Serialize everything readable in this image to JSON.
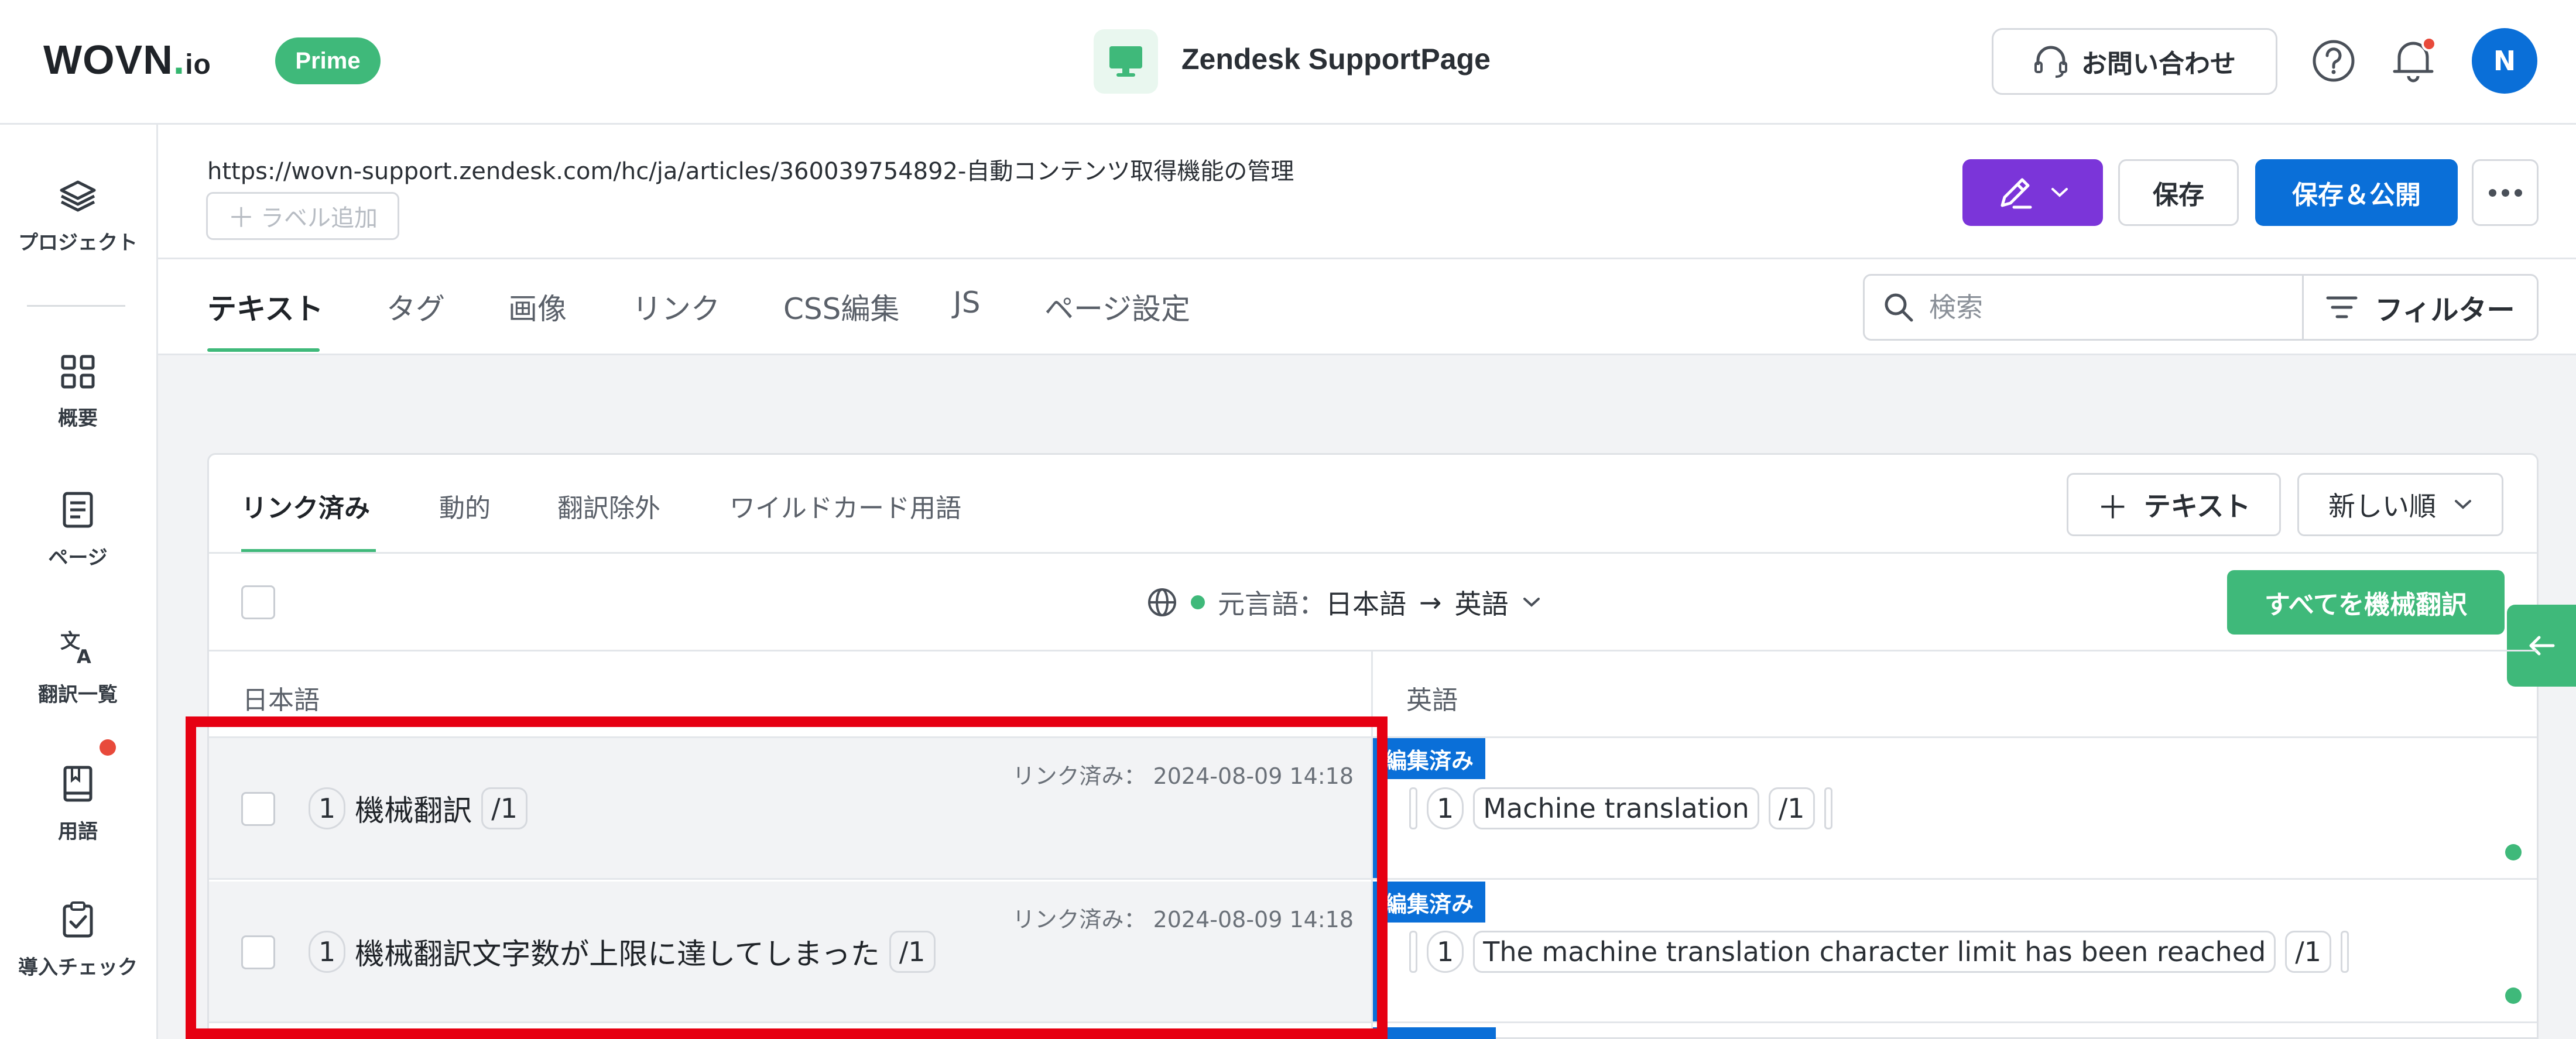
{
  "header": {
    "logo_main": "WOVN",
    "logo_dot": ".",
    "logo_suffix": "io",
    "plan_badge": "Prime",
    "site_name": "Zendesk SupportPage",
    "contact_label": "お問い合わせ",
    "avatar_initial": "N",
    "colors": {
      "brand_green": "#3fb97a",
      "primary_blue": "#0a6fd8",
      "edit_purple": "#7b35d9",
      "notification_red": "#e84a3b"
    }
  },
  "sidebar": {
    "items": [
      {
        "label": "プロジェクト",
        "icon": "layers-icon"
      },
      {
        "label": "概要",
        "icon": "grid-icon"
      },
      {
        "label": "ページ",
        "icon": "document-icon"
      },
      {
        "label": "翻訳一覧",
        "icon": "translate-icon"
      },
      {
        "label": "用語",
        "icon": "book-icon"
      },
      {
        "label": "導入チェック",
        "icon": "clipboard-check-icon"
      }
    ]
  },
  "page": {
    "url": "https://wovn-support.zendesk.com/hc/ja/articles/360039754892-自動コンテンツ取得機能の管理",
    "label_add": "ラベル追加",
    "save_label": "保存",
    "publish_label": "保存＆公開"
  },
  "main_tabs": [
    "テキスト",
    "タグ",
    "画像",
    "リンク",
    "CSS編集",
    "JS",
    "ページ設定"
  ],
  "search": {
    "placeholder": "検索",
    "value": ""
  },
  "filter_label": "フィルター",
  "sub_tabs": [
    "リンク済み",
    "動的",
    "翻訳除外",
    "ワイルドカード用語"
  ],
  "add_text_label": "テキスト",
  "sort": {
    "selected": "新しい順"
  },
  "language": {
    "source_prefix": "元言語：",
    "source": "日本語",
    "arrow": "→",
    "target": "英語"
  },
  "machine_translate_all": "すべてを機械翻訳",
  "columns": {
    "source": "日本語",
    "target": "英語"
  },
  "rows": [
    {
      "linked_meta": "リンク済み： 2024-08-09 14:18",
      "seg_num": "1",
      "source_text": "機械翻訳",
      "end_tag": "/1",
      "edit_badge": "編集済み",
      "target_text": "Machine translation"
    },
    {
      "linked_meta": "リンク済み： 2024-08-09 14:18",
      "seg_num": "1",
      "source_text": "機械翻訳文字数が上限に達してしまった",
      "end_tag": "/1",
      "edit_badge": "編集済み",
      "target_text": "The machine translation character limit has been reached"
    }
  ]
}
